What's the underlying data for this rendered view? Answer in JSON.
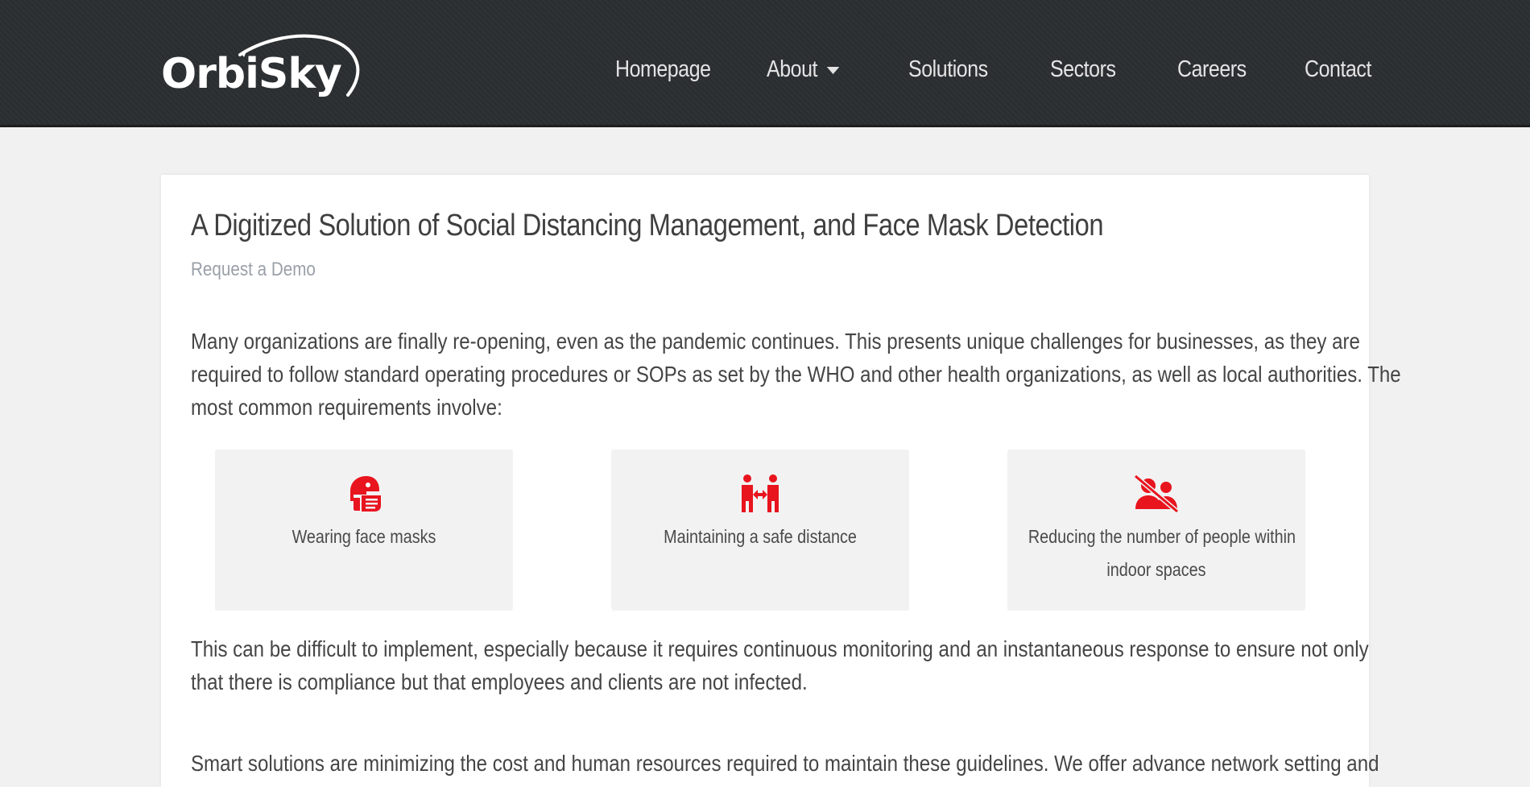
{
  "header": {
    "logo_text": "OrbiSky",
    "nav": [
      {
        "label": "Homepage"
      },
      {
        "label": "About",
        "has_dropdown": true,
        "dropdown_icon": "caret-down-icon"
      },
      {
        "label": "Solutions"
      },
      {
        "label": "Sectors"
      },
      {
        "label": "Careers"
      },
      {
        "label": "Contact"
      }
    ]
  },
  "main": {
    "title": "A Digitized Solution of Social Distancing Management, and Face Mask Detection",
    "subtitle_link": "Request a Demo",
    "intro_lines": [
      "Many organizations are finally re-opening, even as the pandemic continues. This presents unique challenges for businesses, as they are",
      "required to follow standard operating procedures or SOPs as set by the WHO and other health organizations, as well as local authorities. The",
      "most common requirements involve:"
    ],
    "features": [
      {
        "label_lines": [
          "Wearing face masks"
        ],
        "icon": "face-mask-icon"
      },
      {
        "label_lines": [
          "Maintaining a safe distance"
        ],
        "icon": "people-distance-icon"
      },
      {
        "label_lines": [
          "Reducing the number of people within",
          "indoor spaces"
        ],
        "icon": "no-crowd-icon"
      }
    ],
    "followup_lines": [
      "This can be difficult to implement, especially because it requires continuous monitoring and an instantaneous response to ensure not only",
      "that there is compliance but that employees and clients are not infected."
    ],
    "cutoff_line": "Smart solutions are minimizing the cost and human resources required to maintain these guidelines. We offer advance network setting and"
  },
  "colors": {
    "header_bg": "#2b2e31",
    "icon_red": "#e8141e",
    "page_bg": "#f1f1f1",
    "subtitle": "#9aa0a8"
  }
}
